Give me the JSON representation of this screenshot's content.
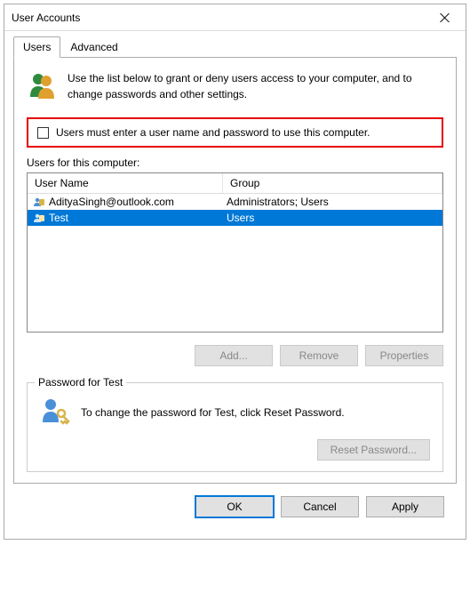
{
  "title": "User Accounts",
  "tabs": {
    "users": "Users",
    "advanced": "Advanced"
  },
  "intro": "Use the list below to grant or deny users access to your computer, and to change passwords and other settings.",
  "checkbox_label": "Users must enter a user name and password to use this computer.",
  "users_label": "Users for this computer:",
  "columns": {
    "name": "User Name",
    "group": "Group"
  },
  "rows": [
    {
      "name": "AdityaSingh@outlook.com",
      "group": "Administrators; Users",
      "selected": false
    },
    {
      "name": "Test",
      "group": "Users",
      "selected": true
    }
  ],
  "buttons": {
    "add": "Add...",
    "remove": "Remove",
    "properties": "Properties"
  },
  "password_group": {
    "legend": "Password for Test",
    "text": "To change the password for Test, click Reset Password.",
    "button": "Reset Password..."
  },
  "bottom": {
    "ok": "OK",
    "cancel": "Cancel",
    "apply": "Apply"
  }
}
